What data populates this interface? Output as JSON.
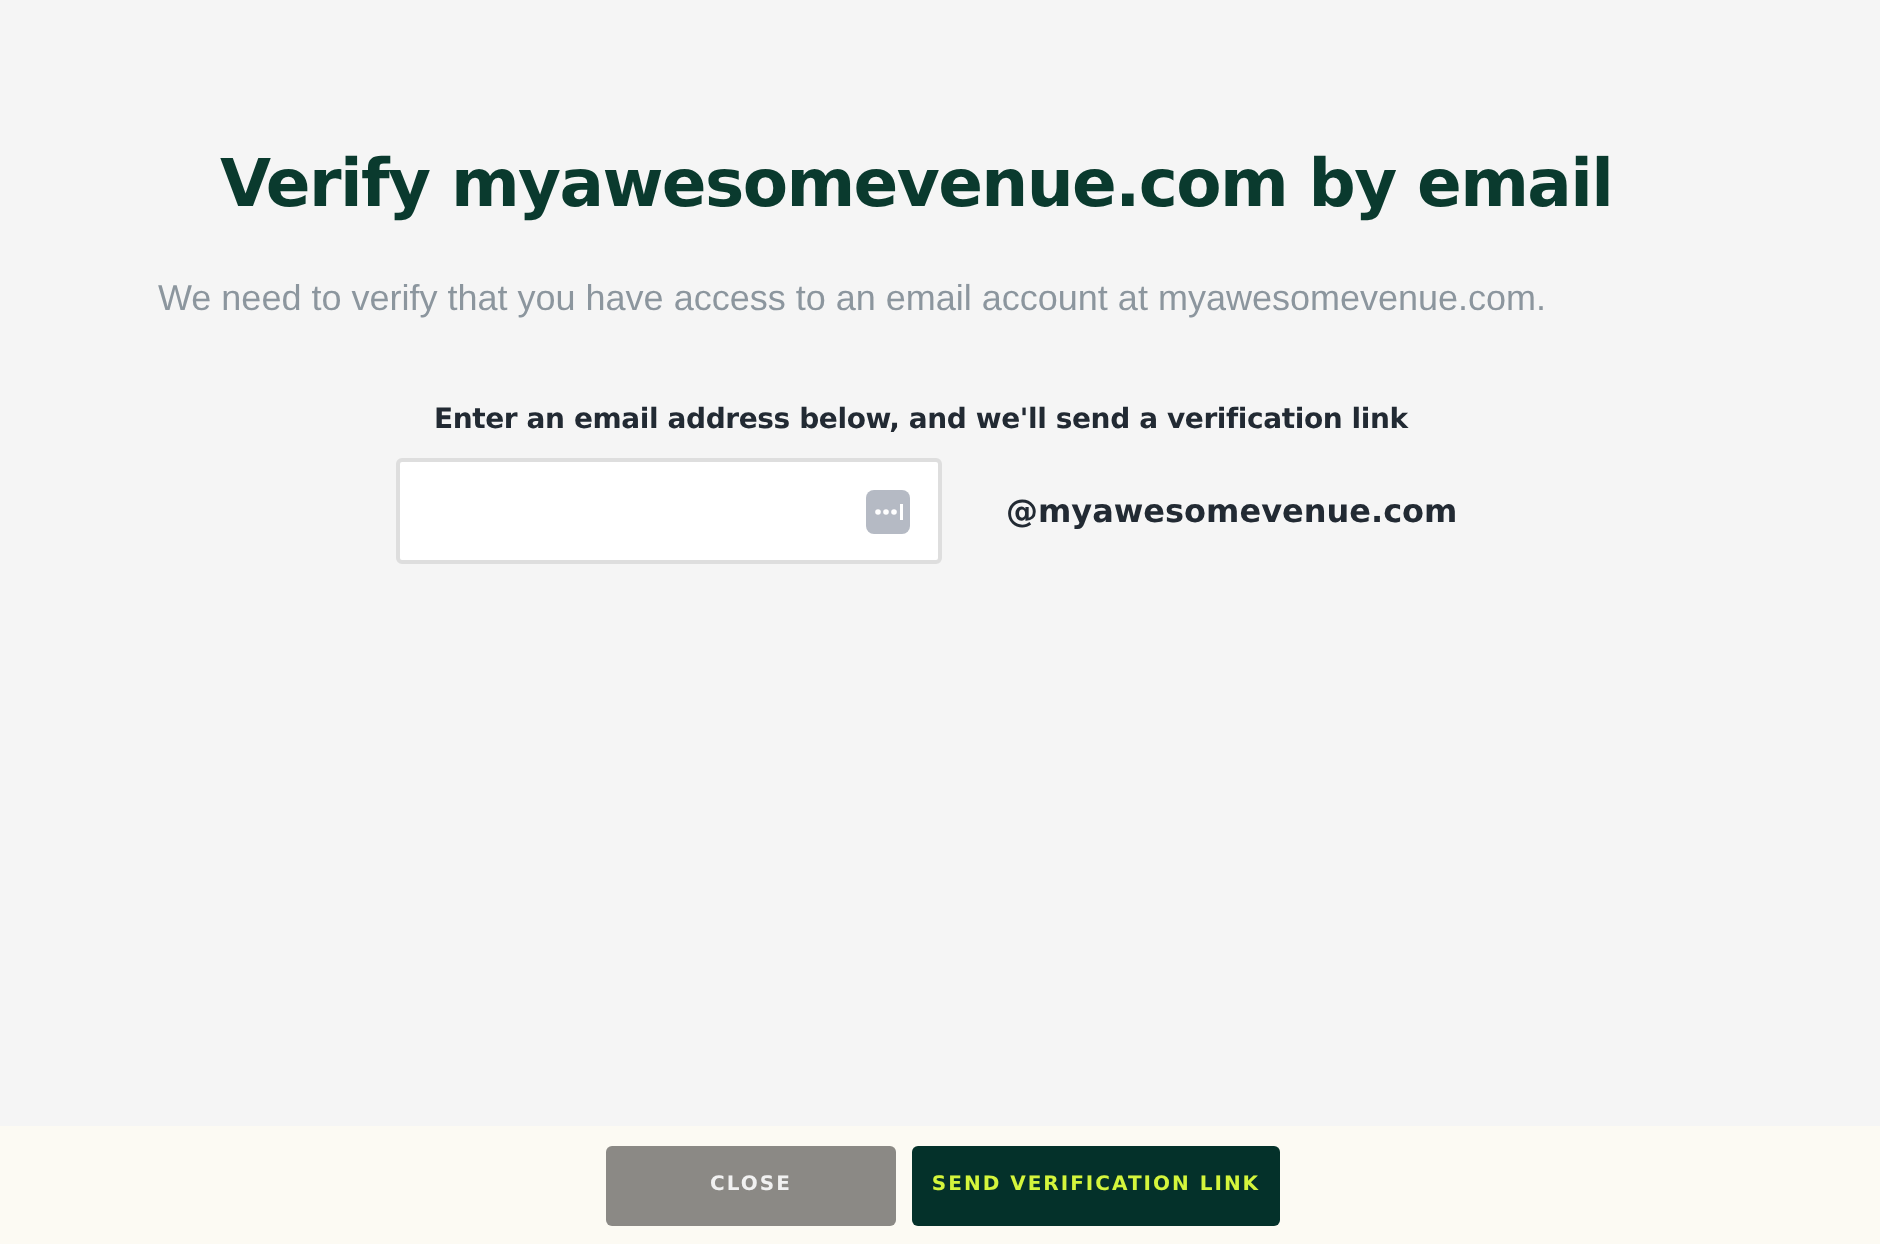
{
  "heading": "Verify myawesomevenue.com by email",
  "description": "We need to verify that you have access to an email account at myawesomevenue.com.",
  "email_field": {
    "label": "Enter an email address below, and we'll send a verification link",
    "suffix": "@myawesomevenue.com"
  },
  "buttons": [
    {
      "label": "CLOSE",
      "kind": "secondary"
    },
    {
      "label": "SEND VERIFICATION LINK",
      "kind": "primary"
    }
  ]
}
